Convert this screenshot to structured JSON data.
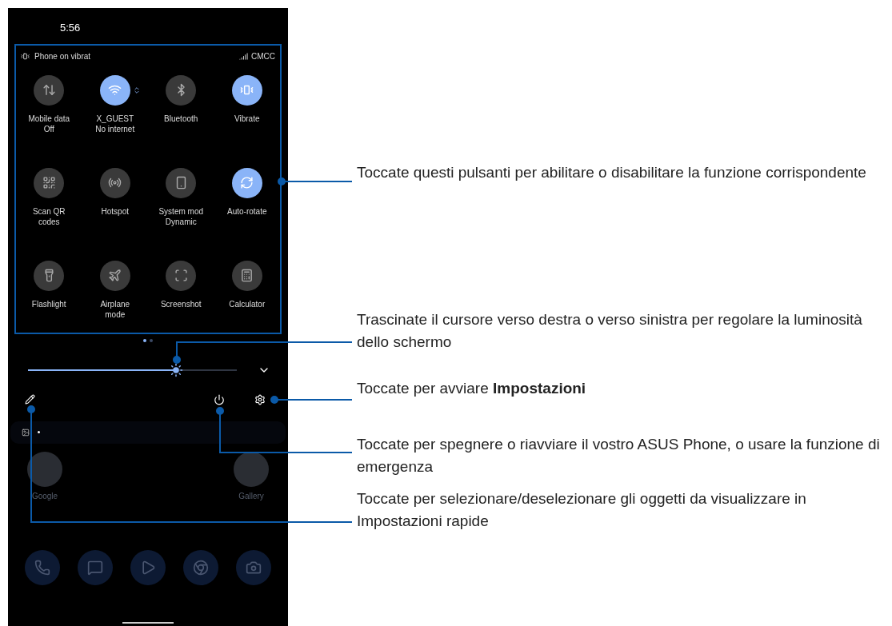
{
  "phone": {
    "time": "5:56",
    "quick_settings": {
      "status_text": "Phone on vibrat",
      "carrier": "CMCC",
      "tiles": [
        {
          "label": "Mobile data",
          "sublabel": "Off",
          "on": false,
          "has_details": false
        },
        {
          "label": "X_GUEST",
          "sublabel": "No internet",
          "on": true,
          "has_details": true
        },
        {
          "label": "Bluetooth",
          "on": false,
          "has_details": false
        },
        {
          "label": "Vibrate",
          "on": true,
          "has_details": false
        },
        {
          "label": "Scan QR",
          "sublabel": "codes",
          "on": false,
          "has_details": false
        },
        {
          "label": "Hotspot",
          "on": false,
          "has_details": false
        },
        {
          "label": "System mod",
          "sublabel": "Dynamic",
          "on": false,
          "has_details": false
        },
        {
          "label": "Auto-rotate",
          "on": true,
          "has_details": false
        },
        {
          "label": "Flashlight",
          "on": false,
          "has_details": false
        },
        {
          "label": "Airplane",
          "sublabel": "mode",
          "on": false,
          "has_details": false
        },
        {
          "label": "Screenshot",
          "on": false,
          "has_details": false
        },
        {
          "label": "Calculator",
          "on": false,
          "has_details": false
        }
      ],
      "pages": [
        {
          "selected": true
        },
        {
          "selected": false
        }
      ]
    },
    "brightness": {
      "level": 0.71
    },
    "home": {
      "apps": [
        {
          "label": "Google"
        },
        {
          "label": "Gallery"
        }
      ]
    }
  },
  "callouts": [
    {
      "text": "Toccate questi pulsanti per abilitare o disabilitare la funzione corrispondente"
    },
    {
      "text": "Trascinate il cursore verso destra o verso sinistra per regolare la luminosità dello schermo"
    },
    {
      "text": "Toccate per avviare **Impostazioni**"
    },
    {
      "text": "Toccate per spegnere o riavviare il vostro ASUS Phone, o usare la funzione di emergenza"
    },
    {
      "text": "Toccate per selezionare/deselezionare gli oggetti da visualizzare in Impostazioni rapide"
    }
  ]
}
